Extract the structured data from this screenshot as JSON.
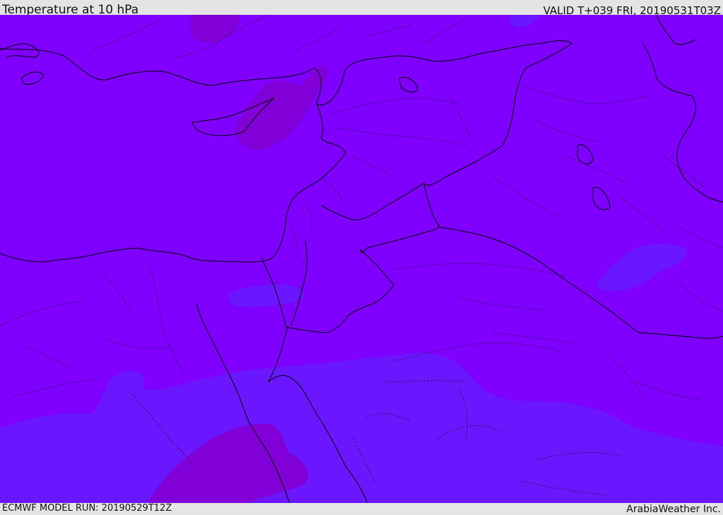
{
  "header": {
    "title": "Temperature at 10 hPa",
    "valid_time": "VALID T+039 FRI, 20190531T03Z"
  },
  "footer": {
    "model_run": "ECMWF MODEL RUN: 20190529T12Z",
    "credit": "ArabiaWeather Inc."
  },
  "map": {
    "region": "Eastern Mediterranean / Middle East",
    "fill_colors": {
      "dominant": "#7f00ff",
      "cooler": "#6a17ff",
      "warmer": "#8200d8"
    },
    "boundary_color": "#000000"
  }
}
